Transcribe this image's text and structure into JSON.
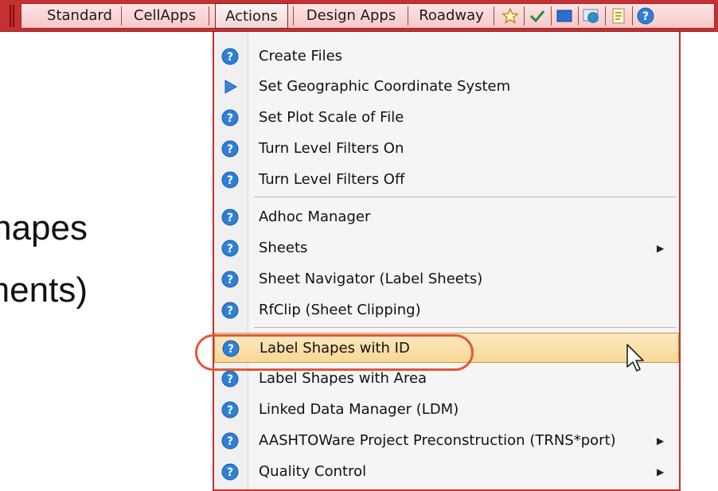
{
  "background": {
    "line1": "Label Shapes.",
    "line2": "(Shape Elements)."
  },
  "toolbar": {
    "items": [
      "Standard",
      "CellApps",
      "Actions",
      "Design Apps",
      "Roadway"
    ],
    "active": "Actions",
    "icons": [
      "star-icon",
      "checkmark-icon",
      "folder-icon",
      "globe-icon",
      "notepad-icon",
      "help-icon"
    ]
  },
  "menu": {
    "items": [
      {
        "label": "Create Files",
        "icon": "help-icon"
      },
      {
        "label": "Set Geographic Coordinate System",
        "icon": "play-icon"
      },
      {
        "label": "Set Plot Scale of File",
        "icon": "help-icon"
      },
      {
        "label": "Turn Level Filters On",
        "icon": "help-icon"
      },
      {
        "label": "Turn Level Filters Off",
        "icon": "help-icon"
      },
      {
        "label": "Adhoc Manager",
        "icon": "help-icon"
      },
      {
        "label": "Sheets",
        "icon": "help-icon",
        "submenu": true
      },
      {
        "label": "Sheet Navigator (Label Sheets)",
        "icon": "help-icon"
      },
      {
        "label": "RfClip (Sheet Clipping)",
        "icon": "help-icon"
      },
      {
        "label": "Label Shapes with ID",
        "icon": "help-icon",
        "highlighted": true
      },
      {
        "label": "Label Shapes with Area",
        "icon": "help-icon"
      },
      {
        "label": "Linked Data Manager (LDM)",
        "icon": "help-icon"
      },
      {
        "label": "AASHTOWare Project Preconstruction (TRNS*port)",
        "icon": "help-icon",
        "submenu": true
      },
      {
        "label": "Quality Control",
        "icon": "help-icon",
        "submenu": true
      }
    ]
  },
  "colors": {
    "toolbar_red": "#c53131",
    "highlight_fill": "#f8d796",
    "oval": "#e05a3a",
    "help_icon": "#2f7fd6"
  }
}
